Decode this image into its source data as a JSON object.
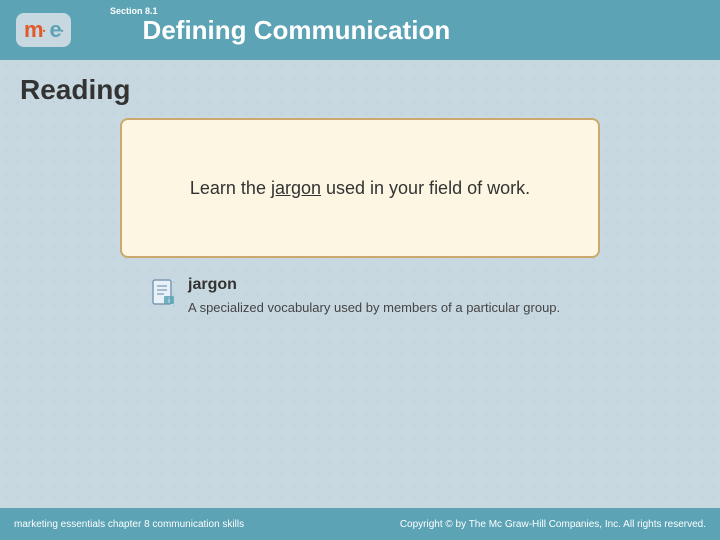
{
  "header": {
    "logo_m": "m",
    "logo_dots": ".",
    "logo_e": "e",
    "section_label": "Section 8.1",
    "title": "Defining Communication"
  },
  "main": {
    "section_heading": "Reading",
    "card_text_prefix": "Learn the ",
    "card_text_term": "jargon",
    "card_text_suffix": " used in your field of work.",
    "definition_term": "jargon",
    "definition_text": "A specialized vocabulary used by members of a particular group."
  },
  "footer": {
    "left_text": "marketing essentials  chapter 8  communication skills",
    "right_text": "Copyright © by The Mc Graw-Hill Companies, Inc. All rights reserved."
  }
}
